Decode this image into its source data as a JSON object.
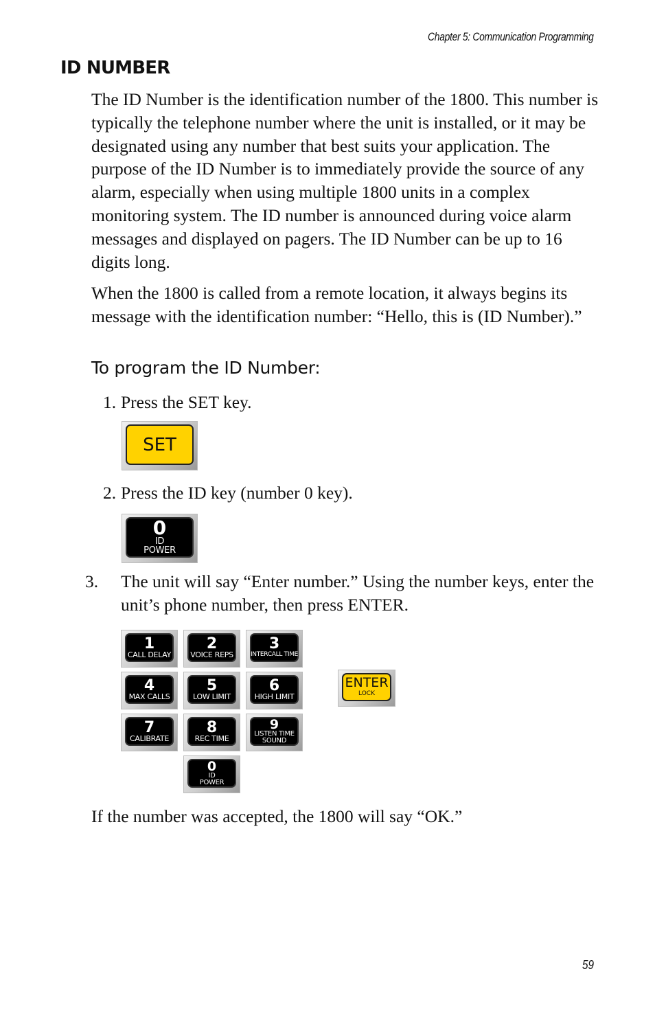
{
  "header": {
    "running_head": "Chapter 5: Communication Programming"
  },
  "section": {
    "title": "ID NUMBER",
    "paragraphs": [
      "The ID Number is the identification number of the 1800. This number is typically the telephone number where the unit is installed, or it may be designated using any number that best suits your application. The purpose of the ID Number is to immediately provide the source of any alarm, especially when using multiple 1800 units in a complex monitoring system. The ID number is announced during voice alarm messages and displayed on pagers. The ID Number can be up to 16 digits long.",
      "When the 1800 is called from a remote location, it always begins its message with the identification number: “Hello, this is (ID Number).”"
    ],
    "subhead": "To program the ID Number:",
    "steps": [
      {
        "num": "1.",
        "text": "Press the SET key."
      },
      {
        "num": "2.",
        "text": "Press the ID key (number 0 key)."
      },
      {
        "num": "3.",
        "text": "The unit will say “Enter number.” Using the number keys, enter the unit’s phone number, then press ENTER."
      }
    ],
    "outro": "If the number was accepted, the 1800 will say “OK.”"
  },
  "keys": {
    "set": {
      "label": "SET",
      "color": "#ffd200"
    },
    "id": {
      "digit": "0",
      "line1": "ID",
      "line2": "POWER"
    },
    "keypad": [
      {
        "digit": "1",
        "line1": "CALL DELAY"
      },
      {
        "digit": "2",
        "line1": "VOICE REPS"
      },
      {
        "digit": "3",
        "line1": "INTERCALL TIME"
      },
      {
        "digit": "4",
        "line1": "MAX CALLS"
      },
      {
        "digit": "5",
        "line1": "LOW LIMIT"
      },
      {
        "digit": "6",
        "line1": "HIGH LIMIT"
      },
      {
        "digit": "7",
        "line1": "CALIBRATE"
      },
      {
        "digit": "8",
        "line1": "REC TIME"
      },
      {
        "digit": "9",
        "line1": "LISTEN TIME",
        "line2": "SOUND"
      },
      {
        "digit": "0",
        "line1": "ID",
        "line2": "POWER"
      }
    ],
    "enter": {
      "label": "ENTER",
      "sub": "LOCK",
      "color": "#ffd200"
    }
  },
  "footer": {
    "page_number": "59"
  }
}
